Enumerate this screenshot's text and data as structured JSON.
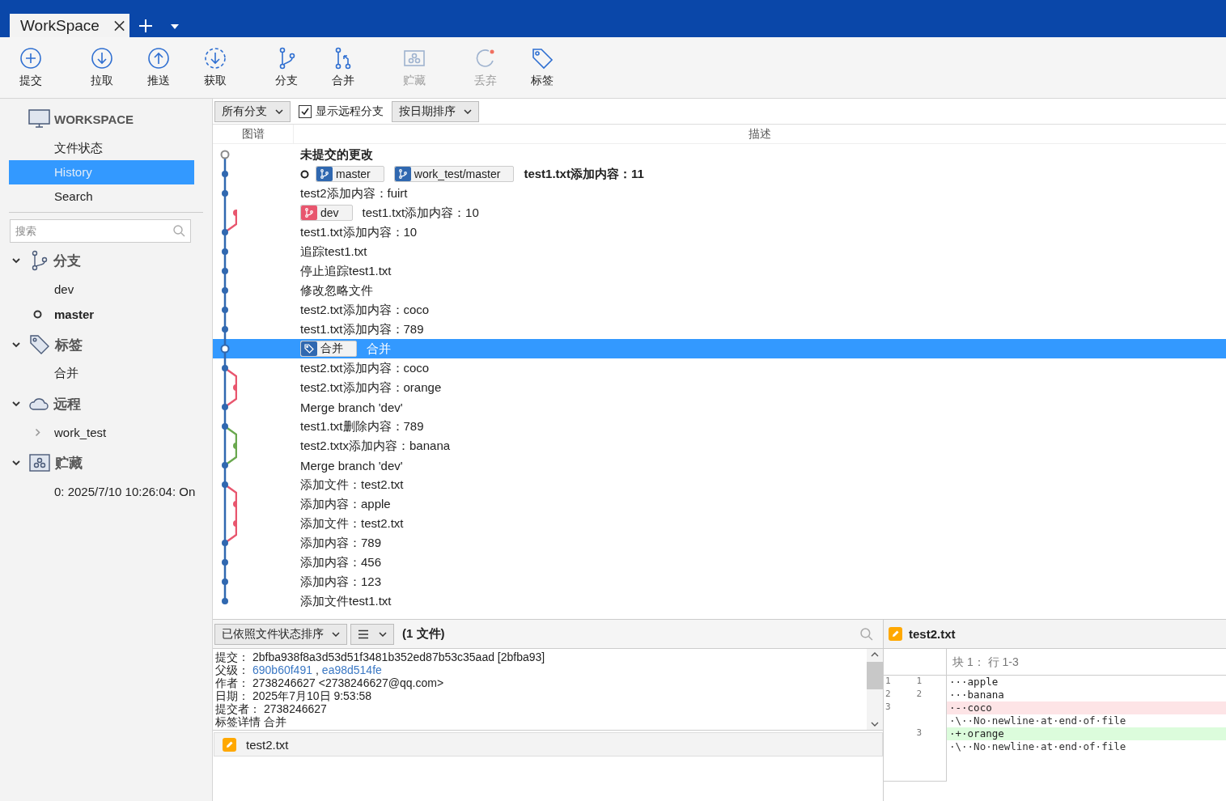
{
  "tab": {
    "title": "WorkSpace"
  },
  "toolbar": [
    {
      "kind": "commit",
      "label": "提交",
      "disabled": false
    },
    {
      "kind": "pull",
      "label": "拉取",
      "disabled": false
    },
    {
      "kind": "push",
      "label": "推送",
      "disabled": false
    },
    {
      "kind": "fetch",
      "label": "获取",
      "disabled": false
    },
    {
      "kind": "branch",
      "label": "分支",
      "disabled": false
    },
    {
      "kind": "merge",
      "label": "合并",
      "disabled": false
    },
    {
      "kind": "stash",
      "label": "贮藏",
      "disabled": true
    },
    {
      "kind": "discard",
      "label": "丢弃",
      "disabled": true
    },
    {
      "kind": "tag",
      "label": "标签",
      "disabled": false
    }
  ],
  "sidebar": {
    "title": "WORKSPACE",
    "nav": [
      {
        "label": "文件状态",
        "selected": false
      },
      {
        "label": "History",
        "selected": true
      },
      {
        "label": "Search",
        "selected": false
      }
    ],
    "search": {
      "placeholder": "搜索"
    },
    "sections": [
      {
        "kind": "branch",
        "label": "分支",
        "expanded": true,
        "items": [
          {
            "label": "dev",
            "current": false
          },
          {
            "label": "master",
            "current": true
          }
        ]
      },
      {
        "kind": "tag",
        "label": "标签",
        "expanded": true,
        "items": [
          {
            "label": "合并",
            "current": false
          }
        ]
      },
      {
        "kind": "remote",
        "label": "远程",
        "expanded": true,
        "items": [
          {
            "label": "work_test",
            "current": false,
            "expanded": false
          }
        ]
      },
      {
        "kind": "stash",
        "label": "贮藏",
        "expanded": true,
        "items": [
          {
            "label": "0: 2025/7/10 10:26:04: On",
            "current": false
          }
        ]
      }
    ]
  },
  "filters": {
    "branches": "所有分支",
    "show_remote": {
      "label": "显示远程分支",
      "checked": true
    },
    "sort": "按日期排序"
  },
  "columns": [
    "图谱",
    "描述"
  ],
  "commits": [
    {
      "kind": "uncommitted",
      "color": "#8a8a8a",
      "selected": false,
      "head": false,
      "text": "未提交的更改"
    },
    {
      "kind": "main",
      "color": "#3068b0",
      "selected": false,
      "head": true,
      "refs": [
        {
          "kind": "branch",
          "label": "master",
          "color": "#3068b0"
        },
        {
          "kind": "branch",
          "label": "work_test/master",
          "color": "#3068b0"
        }
      ],
      "text": "test1.txt添加内容：11"
    },
    {
      "kind": "main",
      "color": "#3068b0",
      "selected": false,
      "head": false,
      "text": "test2添加内容：fuirt"
    },
    {
      "kind": "side",
      "color": "#e8566e",
      "selected": false,
      "head": false,
      "refs": [
        {
          "kind": "branch",
          "label": "dev",
          "color": "#e8566e"
        }
      ],
      "text": "test1.txt添加内容：10"
    },
    {
      "kind": "main",
      "color": "#3068b0",
      "selected": false,
      "head": false,
      "text": "test1.txt添加内容：10"
    },
    {
      "kind": "main",
      "color": "#3068b0",
      "selected": false,
      "head": false,
      "text": "追踪test1.txt"
    },
    {
      "kind": "main",
      "color": "#3068b0",
      "selected": false,
      "head": false,
      "text": "停止追踪test1.txt"
    },
    {
      "kind": "main",
      "color": "#3068b0",
      "selected": false,
      "head": false,
      "text": "修改忽略文件"
    },
    {
      "kind": "main",
      "color": "#3068b0",
      "selected": false,
      "head": false,
      "text": "test2.txt添加内容：coco"
    },
    {
      "kind": "main",
      "color": "#3068b0",
      "selected": false,
      "head": false,
      "text": "test1.txt添加内容：789"
    },
    {
      "kind": "main",
      "color": "#3068b0",
      "selected": true,
      "head": false,
      "refs": [
        {
          "kind": "tag",
          "label": "合并",
          "color": "#3068b0"
        }
      ],
      "text": "合并"
    },
    {
      "kind": "main",
      "color": "#3068b0",
      "selected": false,
      "head": false,
      "text": "test2.txt添加内容：coco"
    },
    {
      "kind": "side",
      "color": "#e8566e",
      "selected": false,
      "head": false,
      "text": "test2.txt添加内容：orange"
    },
    {
      "kind": "main",
      "color": "#3068b0",
      "selected": false,
      "head": false,
      "text": "Merge branch 'dev'"
    },
    {
      "kind": "main",
      "color": "#3068b0",
      "selected": false,
      "head": false,
      "text": "test1.txt删除内容：789"
    },
    {
      "kind": "side",
      "color": "#6aa84f",
      "selected": false,
      "head": false,
      "text": "test2.txtx添加内容：banana"
    },
    {
      "kind": "main",
      "color": "#3068b0",
      "selected": false,
      "head": false,
      "text": "Merge branch 'dev'"
    },
    {
      "kind": "main",
      "color": "#3068b0",
      "selected": false,
      "head": false,
      "text": "添加文件：test2.txt"
    },
    {
      "kind": "side",
      "color": "#e8566e",
      "selected": false,
      "head": false,
      "text": "添加内容：apple"
    },
    {
      "kind": "side",
      "color": "#e8566e",
      "selected": false,
      "head": false,
      "text": "添加文件：test2.txt"
    },
    {
      "kind": "main",
      "color": "#3068b0",
      "selected": false,
      "head": false,
      "text": "添加内容：789"
    },
    {
      "kind": "main",
      "color": "#3068b0",
      "selected": false,
      "head": false,
      "text": "添加内容：456"
    },
    {
      "kind": "main",
      "color": "#3068b0",
      "selected": false,
      "head": false,
      "text": "添加内容：123"
    },
    {
      "kind": "main",
      "color": "#3068b0",
      "selected": false,
      "head": false,
      "text": "添加文件test1.txt"
    }
  ],
  "files_toolbar": {
    "sort": "已依照文件状态排序",
    "count": "(1 文件)"
  },
  "details": [
    {
      "label": "提交：",
      "parts": [
        {
          "kind": "text",
          "text": "2bfba938f8a3d53d51f3481b352ed87b53c35aad [2bfba93]"
        }
      ]
    },
    {
      "label": "父级：",
      "parts": [
        {
          "kind": "link",
          "text": "690b60f491"
        },
        {
          "kind": "text",
          "text": ","
        },
        {
          "kind": "link",
          "text": "ea98d514fe"
        }
      ]
    },
    {
      "label": "作者：",
      "parts": [
        {
          "kind": "text",
          "text": "2738246627 <2738246627@qq.com>"
        }
      ]
    },
    {
      "label": "日期：",
      "parts": [
        {
          "kind": "text",
          "text": "2025年7月10日 9:53:58"
        }
      ]
    },
    {
      "label": "提交者：",
      "parts": [
        {
          "kind": "text",
          "text": "2738246627"
        }
      ]
    },
    {
      "label": "标签详情",
      "parts": [
        {
          "kind": "text",
          "text": "合并"
        }
      ]
    }
  ],
  "files": [
    {
      "name": "test2.txt",
      "selected": false
    }
  ],
  "diff": {
    "file": "test2.txt",
    "hunk": "块 1： 行 1-3",
    "lines": [
      {
        "kind": "context",
        "old": "1",
        "new": "1",
        "text": "···apple"
      },
      {
        "kind": "context",
        "old": "2",
        "new": "2",
        "text": "···banana"
      },
      {
        "kind": "removed",
        "old": "3",
        "text": "·-·coco"
      },
      {
        "kind": "meta",
        "text": "·\\··No·newline·at·end·of·file"
      },
      {
        "kind": "added",
        "new": "3",
        "text": "·+·orange"
      },
      {
        "kind": "meta",
        "text": "·\\··No·newline·at·end·of·file"
      }
    ]
  }
}
